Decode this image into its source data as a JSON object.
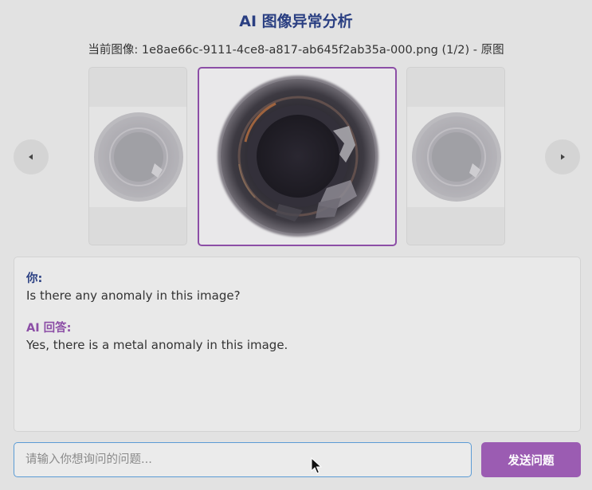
{
  "header": {
    "title": "AI 图像异常分析",
    "current_image_label": "当前图像: 1e8ae66c-9111-4ce8-a817-ab645f2ab35a-000.png (1/2) - 原图"
  },
  "carousel": {
    "prev_icon": "chevron-left-icon",
    "next_icon": "chevron-right-icon",
    "image_subject": "bottle-top-view"
  },
  "chat": {
    "messages": [
      {
        "speaker": "你:",
        "text": "Is there any anomaly in this image?"
      },
      {
        "speaker": "AI 回答:",
        "text": "Yes, there is a metal anomaly in this image."
      }
    ]
  },
  "composer": {
    "placeholder": "请输入你想询问的问题...",
    "value": "",
    "send_label": "发送问题"
  },
  "colors": {
    "title": "#2a3f82",
    "ai_accent": "#8c4ea6",
    "send_button": "#9b5cb2",
    "input_border": "#5b9bd5",
    "background": "#e2e2e2"
  }
}
